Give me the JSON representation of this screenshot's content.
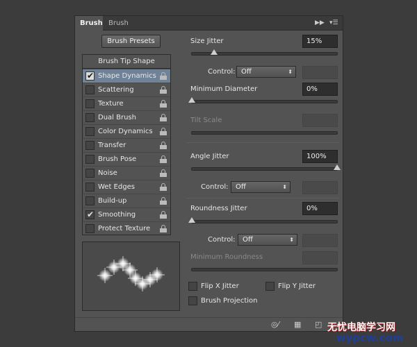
{
  "tabs": [
    {
      "label": "Brush",
      "active": true
    },
    {
      "label": "Brush Presets",
      "active": false
    }
  ],
  "tab_icons": [
    "fast-forward-icon",
    "panel-menu-icon"
  ],
  "brush_presets_button": "Brush Presets",
  "options": {
    "header": "Brush Tip Shape",
    "items": [
      {
        "label": "Shape Dynamics",
        "checked": true,
        "selected": true
      },
      {
        "label": "Scattering",
        "checked": false
      },
      {
        "label": "Texture",
        "checked": false
      },
      {
        "label": "Dual Brush",
        "checked": false
      },
      {
        "label": "Color Dynamics",
        "checked": false
      },
      {
        "label": "Transfer",
        "checked": false
      },
      {
        "label": "Brush Pose",
        "checked": false
      },
      {
        "label": "Noise",
        "checked": false
      },
      {
        "label": "Wet Edges",
        "checked": false
      },
      {
        "label": "Build-up",
        "checked": false
      },
      {
        "label": "Smoothing",
        "checked": true
      },
      {
        "label": "Protect Texture",
        "checked": false
      }
    ]
  },
  "settings": {
    "size_jitter": {
      "label": "Size Jitter",
      "value": "15%",
      "slider": 0.15
    },
    "control1": {
      "label": "Control:",
      "value": "Off"
    },
    "min_diameter": {
      "label": "Minimum Diameter",
      "value": "0%",
      "slider": 0.0
    },
    "tilt_scale": {
      "label": "Tilt Scale",
      "value": ""
    },
    "angle_jitter": {
      "label": "Angle Jitter",
      "value": "100%",
      "slider": 1.0
    },
    "control2": {
      "label": "Control:",
      "value": "Off"
    },
    "roundness_jitter": {
      "label": "Roundness Jitter",
      "value": "0%",
      "slider": 0.0
    },
    "control3": {
      "label": "Control:",
      "value": "Off"
    },
    "min_roundness": {
      "label": "Minimum Roundness",
      "value": ""
    },
    "flip_x": {
      "label": "Flip X Jitter",
      "checked": false
    },
    "flip_y": {
      "label": "Flip Y Jitter",
      "checked": false
    },
    "projection": {
      "label": "Brush Projection",
      "checked": false
    }
  },
  "bottom_icons": [
    "toggle-live-tip-icon",
    "grid-icon",
    "new-preset-icon"
  ],
  "watermark": {
    "line1": "无忧电脑学习网",
    "line2": "wypcw.com"
  },
  "colors": {
    "panel": "#535353",
    "selected_row": "#6f8297",
    "field": "#2e2e2e"
  }
}
